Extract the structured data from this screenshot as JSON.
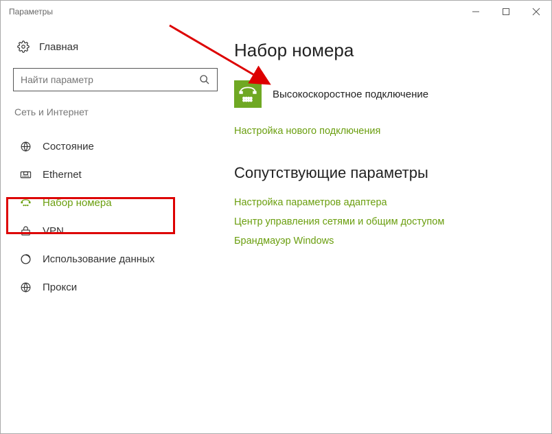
{
  "titlebar": {
    "title": "Параметры"
  },
  "sidebar": {
    "home": "Главная",
    "search_placeholder": "Найти параметр",
    "category": "Сеть и Интернет",
    "items": [
      {
        "label": "Состояние"
      },
      {
        "label": "Ethernet"
      },
      {
        "label": "Набор номера"
      },
      {
        "label": "VPN"
      },
      {
        "label": "Использование данных"
      },
      {
        "label": "Прокси"
      }
    ]
  },
  "main": {
    "title": "Набор номера",
    "connection": "Высокоскоростное подключение",
    "new_connection_link": "Настройка нового подключения",
    "related_title": "Сопутствующие параметры",
    "links": [
      "Настройка параметров адаптера",
      "Центр управления сетями и общим доступом",
      "Брандмауэр Windows"
    ]
  }
}
